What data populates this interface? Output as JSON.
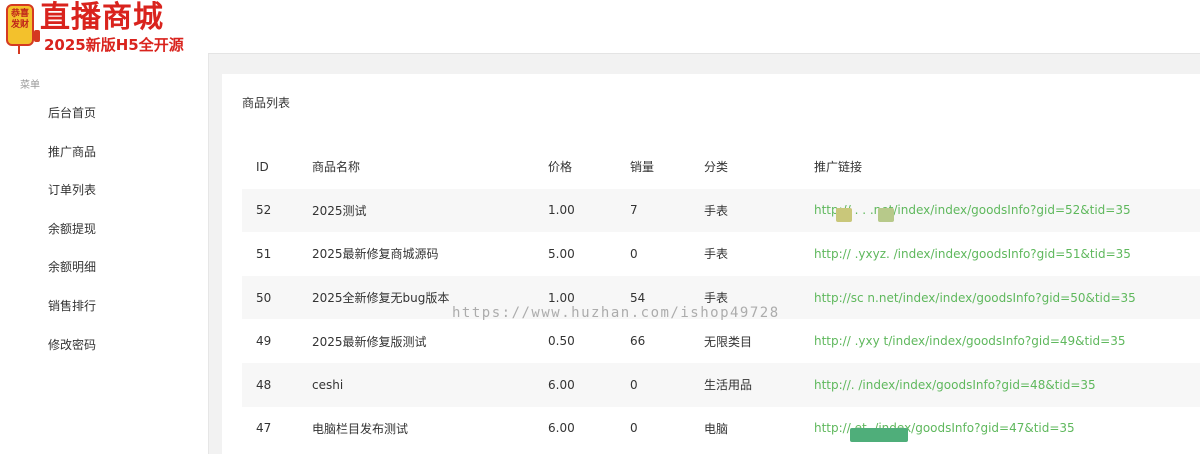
{
  "logo": {
    "badge_text": "恭喜发财",
    "title": "直播商城",
    "subtitle": "2025新版H5全开源"
  },
  "sidebar": {
    "caption": "菜单",
    "items": [
      {
        "label": "后台首页"
      },
      {
        "label": "推广商品"
      },
      {
        "label": "订单列表"
      },
      {
        "label": "余额提现"
      },
      {
        "label": "余额明细"
      },
      {
        "label": "销售排行"
      },
      {
        "label": "修改密码"
      }
    ]
  },
  "main": {
    "title": "商品列表",
    "columns": [
      "ID",
      "商品名称",
      "价格",
      "销量",
      "分类",
      "推广链接"
    ],
    "rows": [
      {
        "id": "52",
        "name": "2025测试",
        "price": "1.00",
        "sales": "7",
        "category": "手表",
        "link": "http://  .  . .net/index/index/goodsInfo?gid=52&tid=35"
      },
      {
        "id": "51",
        "name": "2025最新修复商城源码",
        "price": "5.00",
        "sales": "0",
        "category": "手表",
        "link": "http://    .yxyz.  /index/index/goodsInfo?gid=51&tid=35"
      },
      {
        "id": "50",
        "name": "2025全新修复无bug版本",
        "price": "1.00",
        "sales": "54",
        "category": "手表",
        "link": "http://sc        n.net/index/index/goodsInfo?gid=50&tid=35"
      },
      {
        "id": "49",
        "name": "2025最新修复版测试",
        "price": "0.50",
        "sales": "66",
        "category": "无限类目",
        "link": "http://       .yxy    t/index/index/goodsInfo?gid=49&tid=35"
      },
      {
        "id": "48",
        "name": "ceshi",
        "price": "6.00",
        "sales": "0",
        "category": "生活用品",
        "link": "http://.        /index/index/goodsInfo?gid=48&tid=35"
      },
      {
        "id": "47",
        "name": "电脑栏目发布测试",
        "price": "6.00",
        "sales": "0",
        "category": "电脑",
        "link": "http://            et.     /index/goodsInfo?gid=47&tid=35"
      }
    ]
  },
  "watermark": "https://www.huzhan.com/ishop49728"
}
